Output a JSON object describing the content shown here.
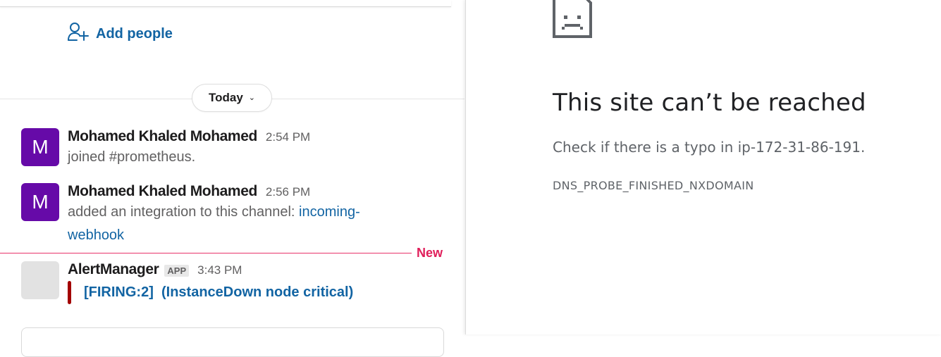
{
  "slack": {
    "add_people_label": "Add people",
    "date_divider": "Today",
    "new_marker": "New",
    "messages": [
      {
        "avatar_letter": "M",
        "avatar_color": "#660aa8",
        "author": "Mohamed Khaled Mohamed",
        "time": "2:54 PM",
        "text": "joined #prometheus."
      },
      {
        "avatar_letter": "M",
        "avatar_color": "#660aa8",
        "author": "Mohamed Khaled Mohamed",
        "time": "2:56 PM",
        "text_prefix": "added an integration to this channel: ",
        "link_text_line1": "incoming-",
        "link_text_line2": "webhook"
      },
      {
        "author": "AlertManager",
        "badge": "APP",
        "time": "3:43 PM",
        "attachment_title": "[FIRING:2]  (InstanceDown node critical)",
        "attachment_color": "#a30200"
      }
    ]
  },
  "browser_error": {
    "icon": "sad-page-icon",
    "title": "This site can’t be reached",
    "subtitle": "Check if there is a typo in ip-172-31-86-191.",
    "error_code": "DNS_PROBE_FINISHED_NXDOMAIN"
  }
}
